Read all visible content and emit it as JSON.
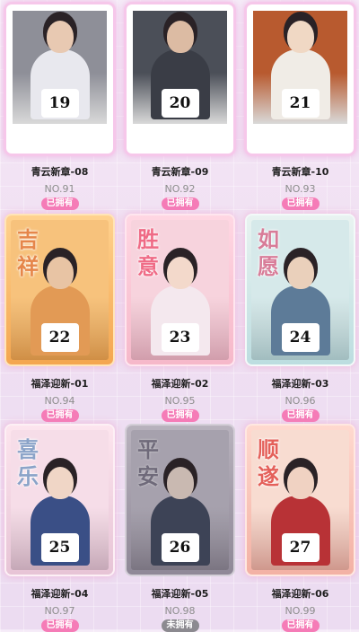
{
  "cards": [
    {
      "num": "19",
      "name": "青云新章-08",
      "no": "NO.91",
      "status": "已拥有",
      "owned": true,
      "chars": [
        "",
        ""
      ],
      "frame": "white",
      "bg": "#8e8f98",
      "robe": "#e8e8ee",
      "skin": "#e8c9b2"
    },
    {
      "num": "20",
      "name": "青云新章-09",
      "no": "NO.92",
      "status": "已拥有",
      "owned": true,
      "chars": [
        "",
        ""
      ],
      "frame": "white",
      "bg": "#4b4f58",
      "robe": "#3a3d46",
      "skin": "#dcbba3"
    },
    {
      "num": "21",
      "name": "青云新章-10",
      "no": "NO.93",
      "status": "已拥有",
      "owned": true,
      "chars": [
        "",
        ""
      ],
      "frame": "white",
      "bg": "#b85a2f",
      "robe": "#f0ece6",
      "skin": "#f0d8c4"
    },
    {
      "num": "22",
      "name": "福泽迎新-01",
      "no": "NO.94",
      "status": "已拥有",
      "owned": true,
      "chars": [
        "吉",
        "祥"
      ],
      "frame": "orange",
      "bg": "#f7c27c",
      "robe": "#e29a55",
      "skin": "#e8c4a4"
    },
    {
      "num": "23",
      "name": "福泽迎新-02",
      "no": "NO.95",
      "status": "已拥有",
      "owned": true,
      "chars": [
        "胜",
        "意"
      ],
      "frame": "pink",
      "bg": "#f7d3dd",
      "robe": "#f4e8ee",
      "skin": "#f3d9cb"
    },
    {
      "num": "24",
      "name": "福泽迎新-03",
      "no": "NO.96",
      "status": "已拥有",
      "owned": true,
      "chars": [
        "如",
        "愿"
      ],
      "frame": "teal",
      "bg": "#d6e9ea",
      "robe": "#5d7b98",
      "skin": "#ead0bb"
    },
    {
      "num": "25",
      "name": "福泽迎新-04",
      "no": "NO.97",
      "status": "已拥有",
      "owned": true,
      "chars": [
        "喜",
        "乐"
      ],
      "frame": "blue",
      "bg": "#f6dde8",
      "robe": "#3a4f86",
      "skin": "#f0d6c6"
    },
    {
      "num": "26",
      "name": "福泽迎新-05",
      "no": "NO.98",
      "status": "未拥有",
      "owned": false,
      "chars": [
        "平",
        "安"
      ],
      "frame": "grey",
      "bg": "#a6a1ad",
      "robe": "#3d4356",
      "skin": "#c9b9b1"
    },
    {
      "num": "27",
      "name": "福泽迎新-06",
      "no": "NO.99",
      "status": "已拥有",
      "owned": true,
      "chars": [
        "顺",
        "遂"
      ],
      "frame": "red",
      "bg": "#f8dcd1",
      "robe": "#b83236",
      "skin": "#f0d2c2"
    }
  ]
}
